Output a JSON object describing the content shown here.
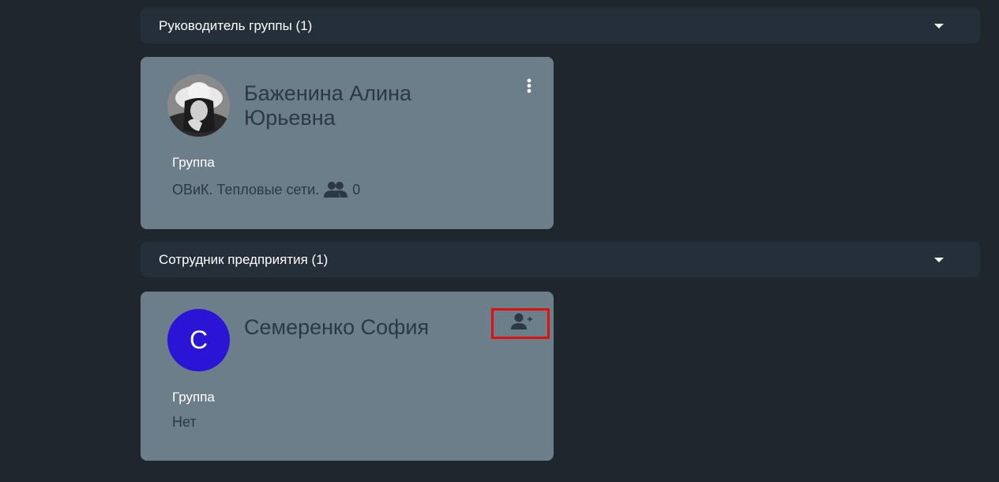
{
  "sections": [
    {
      "title": "Руководитель группы (1)",
      "card": {
        "name": "Баженина Алина Юрьевна",
        "group_label": "Группа",
        "group_value": "ОВиК. Тепловые сети.",
        "members_count": "0"
      }
    },
    {
      "title": "Сотрудник предприятия (1)",
      "card": {
        "avatar_letter": "С",
        "name": "Семеренко София",
        "group_label": "Группа",
        "group_value": "Нет"
      }
    }
  ],
  "icons": {
    "section_toggle": "caret-down-icon",
    "card_menu": "more-vertical-icon",
    "members": "people-icon",
    "add_to_group": "person-add-icon"
  },
  "colors": {
    "background": "#1e262e",
    "section_header": "#252f3a",
    "card": "#6d7e8b",
    "avatar_letter_bg": "#2a14d6",
    "highlight": "#e01010"
  }
}
